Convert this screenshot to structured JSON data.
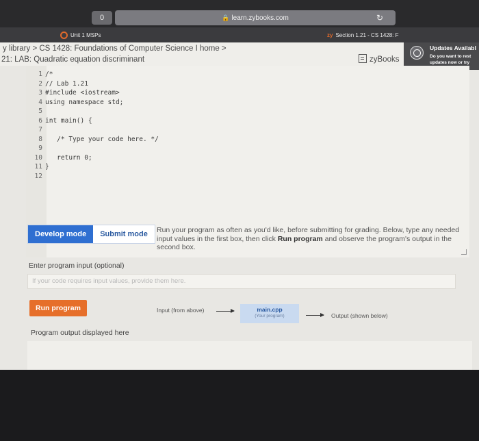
{
  "browser": {
    "shield_label": "0",
    "url": "learn.zybooks.com",
    "tabs": [
      {
        "label": "Unit 1 MSPs"
      },
      {
        "prefix": "zy",
        "label": "Section 1.21 - CS 1428: F"
      }
    ]
  },
  "header": {
    "breadcrumb": "y library > CS 1428: Foundations of Computer Science I home >",
    "lab_title": "21: LAB: Quadratic equation discriminant",
    "zybooks_label": "zyBooks"
  },
  "update_notice": {
    "title": "Updates Availabl",
    "line1": "Do you want to rest",
    "line2": "updates now or try"
  },
  "editor": {
    "lines": [
      {
        "num": "1",
        "text": "/*"
      },
      {
        "num": "2",
        "text": "// Lab 1.21"
      },
      {
        "num": "3",
        "text": "#include <iostream>"
      },
      {
        "num": "4",
        "text": "using namespace std;"
      },
      {
        "num": "5",
        "text": ""
      },
      {
        "num": "6",
        "text": "int main() {"
      },
      {
        "num": "7",
        "text": ""
      },
      {
        "num": "8",
        "text": "   /* Type your code here. */"
      },
      {
        "num": "9",
        "text": ""
      },
      {
        "num": "10",
        "text": "   return 0;"
      },
      {
        "num": "11",
        "text": "}"
      },
      {
        "num": "12",
        "text": ""
      }
    ]
  },
  "controls": {
    "develop_mode": "Develop mode",
    "submit_mode": "Submit mode",
    "help_text_1": "Run your program as often as you'd like, before submitting for grading. Below, type any needed input values in the first box, then click ",
    "help_bold": "Run program",
    "help_text_2": " and observe the program's output in the second box.",
    "input_label": "Enter program input (optional)",
    "input_placeholder": "If your code requires input values, provide them here.",
    "run_button": "Run program",
    "flow_input": "Input (from above)",
    "file_name": "main.cpp",
    "file_sub": "(Your program)",
    "flow_output": "Output (shown below)",
    "output_label": "Program output displayed here"
  },
  "colors": {
    "accent_orange": "#e66f2a",
    "mode_blue": "#2f6fd1",
    "file_box": "#c9daf0"
  }
}
